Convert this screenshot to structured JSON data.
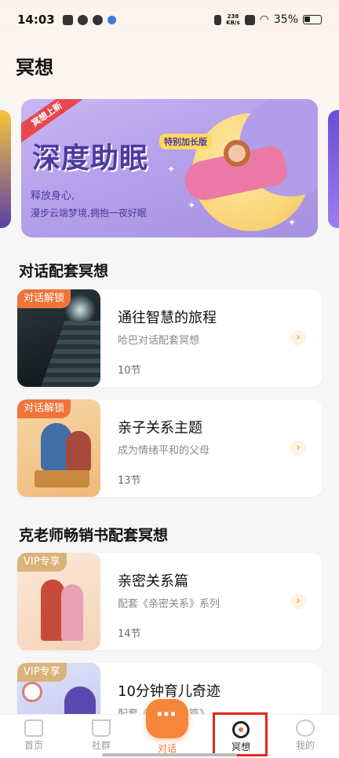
{
  "status_bar": {
    "time": "14:03",
    "net_speed_top": "238",
    "net_speed_unit": "KB/s",
    "battery": "35%"
  },
  "page": {
    "title": "冥想"
  },
  "banner": {
    "ribbon": "冥想上新",
    "headline": "深度助眠",
    "tag": "特别加长版",
    "line1": "释放身心,",
    "line2": "漫步云端梦境,拥抱一夜好眠"
  },
  "sections": [
    {
      "title": "对话配套冥想",
      "items": [
        {
          "badge": "对话解锁",
          "title": "通往智慧的旅程",
          "desc": "哈巴对话配套冥想",
          "count": "10节"
        },
        {
          "badge": "对话解锁",
          "title": "亲子关系主题",
          "desc": "成为情绪平和的父母",
          "count": "13节"
        }
      ]
    },
    {
      "title": "克老师畅销书配套冥想",
      "items": [
        {
          "badge": "VIP专享",
          "title": "亲密关系篇",
          "desc": "配套《亲密关系》系列",
          "count": "14节"
        },
        {
          "badge": "VIP专享",
          "title": "10分钟育儿奇迹",
          "desc": "配套《亲子关系篇》",
          "count": ""
        }
      ]
    }
  ],
  "nav": {
    "home": "首页",
    "community": "社群",
    "chat": "对话",
    "meditate": "冥想",
    "mine": "我的",
    "center_icon": "⋯"
  },
  "colors": {
    "accent": "#f0733a",
    "vip": "#d9b37a",
    "highlight": "#e0261e"
  }
}
